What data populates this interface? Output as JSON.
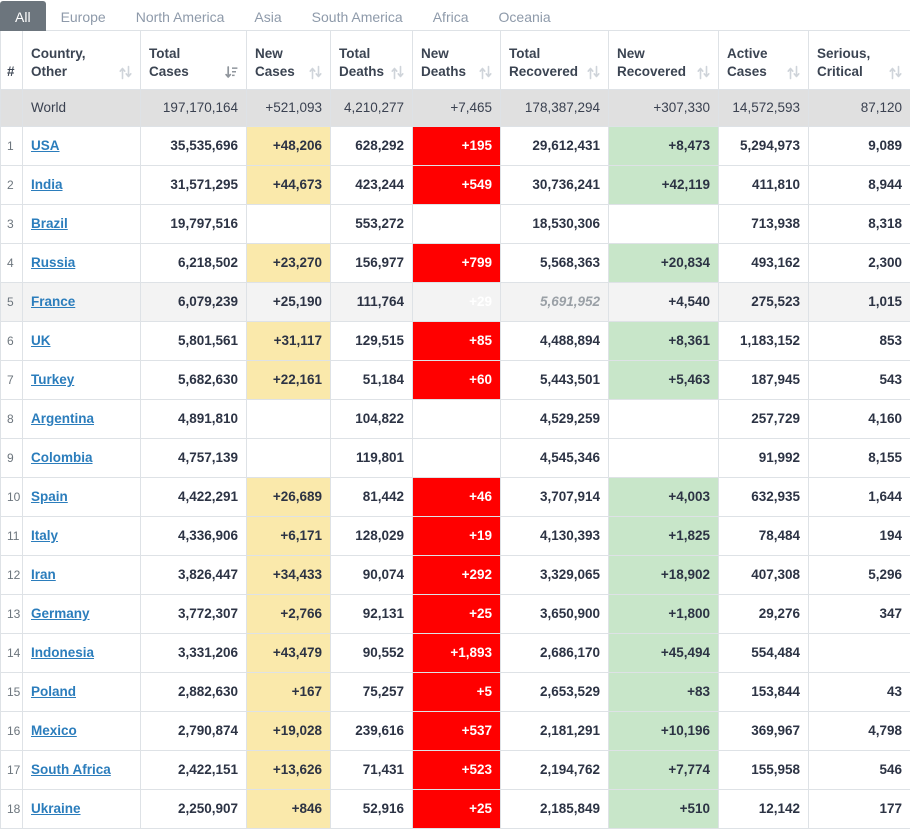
{
  "tabs": [
    {
      "label": "All",
      "active": true
    },
    {
      "label": "Europe",
      "active": false
    },
    {
      "label": "North America",
      "active": false
    },
    {
      "label": "Asia",
      "active": false
    },
    {
      "label": "South America",
      "active": false
    },
    {
      "label": "Africa",
      "active": false
    },
    {
      "label": "Oceania",
      "active": false
    }
  ],
  "colors": {
    "new_cases_bg": "#fae9ab",
    "new_deaths_bg": "#ff0000",
    "new_recovered_bg": "#c8e6c9",
    "world_row_bg": "#e0e0e0",
    "striped_row_bg": "#f3f3f3",
    "link": "#2b7dbc",
    "active_tab_bg": "#6c757d"
  },
  "columns": [
    {
      "key": "num",
      "line1": "",
      "line2": "#",
      "sort": "none"
    },
    {
      "key": "country",
      "line1": "Country,",
      "line2": "Other",
      "sort": "none"
    },
    {
      "key": "total_cases",
      "line1": "Total",
      "line2": "Cases",
      "sort": "desc"
    },
    {
      "key": "new_cases",
      "line1": "New",
      "line2": "Cases",
      "sort": "none"
    },
    {
      "key": "total_deaths",
      "line1": "Total",
      "line2": "Deaths",
      "sort": "none"
    },
    {
      "key": "new_deaths",
      "line1": "New",
      "line2": "Deaths",
      "sort": "none"
    },
    {
      "key": "total_recovered",
      "line1": "Total",
      "line2": "Recovered",
      "sort": "none"
    },
    {
      "key": "new_recovered",
      "line1": "New",
      "line2": "Recovered",
      "sort": "none"
    },
    {
      "key": "active_cases",
      "line1": "Active",
      "line2": "Cases",
      "sort": "none"
    },
    {
      "key": "serious_critical",
      "line1": "Serious,",
      "line2": "Critical",
      "sort": "none"
    }
  ],
  "world_row": {
    "num": "",
    "country": "World",
    "total_cases": "197,170,164",
    "new_cases": "+521,093",
    "total_deaths": "4,210,277",
    "new_deaths": "+7,465",
    "total_recovered": "178,387,294",
    "new_recovered": "+307,330",
    "active_cases": "14,572,593",
    "serious_critical": "87,120"
  },
  "rows": [
    {
      "num": "1",
      "country": "USA",
      "total_cases": "35,535,696",
      "new_cases": "+48,206",
      "total_deaths": "628,292",
      "new_deaths": "+195",
      "total_recovered": "29,612,431",
      "new_recovered": "+8,473",
      "active_cases": "5,294,973",
      "serious_critical": "9,089",
      "striped": false,
      "recovered_muted": false
    },
    {
      "num": "2",
      "country": "India",
      "total_cases": "31,571,295",
      "new_cases": "+44,673",
      "total_deaths": "423,244",
      "new_deaths": "+549",
      "total_recovered": "30,736,241",
      "new_recovered": "+42,119",
      "active_cases": "411,810",
      "serious_critical": "8,944",
      "striped": false,
      "recovered_muted": false
    },
    {
      "num": "3",
      "country": "Brazil",
      "total_cases": "19,797,516",
      "new_cases": "",
      "total_deaths": "553,272",
      "new_deaths": "",
      "total_recovered": "18,530,306",
      "new_recovered": "",
      "active_cases": "713,938",
      "serious_critical": "8,318",
      "striped": false,
      "recovered_muted": false
    },
    {
      "num": "4",
      "country": "Russia",
      "total_cases": "6,218,502",
      "new_cases": "+23,270",
      "total_deaths": "156,977",
      "new_deaths": "+799",
      "total_recovered": "5,568,363",
      "new_recovered": "+20,834",
      "active_cases": "493,162",
      "serious_critical": "2,300",
      "striped": false,
      "recovered_muted": false
    },
    {
      "num": "5",
      "country": "France",
      "total_cases": "6,079,239",
      "new_cases": "+25,190",
      "total_deaths": "111,764",
      "new_deaths": "+29",
      "total_recovered": "5,691,952",
      "new_recovered": "+4,540",
      "active_cases": "275,523",
      "serious_critical": "1,015",
      "striped": true,
      "recovered_muted": true
    },
    {
      "num": "6",
      "country": "UK",
      "total_cases": "5,801,561",
      "new_cases": "+31,117",
      "total_deaths": "129,515",
      "new_deaths": "+85",
      "total_recovered": "4,488,894",
      "new_recovered": "+8,361",
      "active_cases": "1,183,152",
      "serious_critical": "853",
      "striped": false,
      "recovered_muted": false
    },
    {
      "num": "7",
      "country": "Turkey",
      "total_cases": "5,682,630",
      "new_cases": "+22,161",
      "total_deaths": "51,184",
      "new_deaths": "+60",
      "total_recovered": "5,443,501",
      "new_recovered": "+5,463",
      "active_cases": "187,945",
      "serious_critical": "543",
      "striped": false,
      "recovered_muted": false
    },
    {
      "num": "8",
      "country": "Argentina",
      "total_cases": "4,891,810",
      "new_cases": "",
      "total_deaths": "104,822",
      "new_deaths": "",
      "total_recovered": "4,529,259",
      "new_recovered": "",
      "active_cases": "257,729",
      "serious_critical": "4,160",
      "striped": false,
      "recovered_muted": false
    },
    {
      "num": "9",
      "country": "Colombia",
      "total_cases": "4,757,139",
      "new_cases": "",
      "total_deaths": "119,801",
      "new_deaths": "",
      "total_recovered": "4,545,346",
      "new_recovered": "",
      "active_cases": "91,992",
      "serious_critical": "8,155",
      "striped": false,
      "recovered_muted": false
    },
    {
      "num": "10",
      "country": "Spain",
      "total_cases": "4,422,291",
      "new_cases": "+26,689",
      "total_deaths": "81,442",
      "new_deaths": "+46",
      "total_recovered": "3,707,914",
      "new_recovered": "+4,003",
      "active_cases": "632,935",
      "serious_critical": "1,644",
      "striped": false,
      "recovered_muted": false
    },
    {
      "num": "11",
      "country": "Italy",
      "total_cases": "4,336,906",
      "new_cases": "+6,171",
      "total_deaths": "128,029",
      "new_deaths": "+19",
      "total_recovered": "4,130,393",
      "new_recovered": "+1,825",
      "active_cases": "78,484",
      "serious_critical": "194",
      "striped": false,
      "recovered_muted": false
    },
    {
      "num": "12",
      "country": "Iran",
      "total_cases": "3,826,447",
      "new_cases": "+34,433",
      "total_deaths": "90,074",
      "new_deaths": "+292",
      "total_recovered": "3,329,065",
      "new_recovered": "+18,902",
      "active_cases": "407,308",
      "serious_critical": "5,296",
      "striped": false,
      "recovered_muted": false
    },
    {
      "num": "13",
      "country": "Germany",
      "total_cases": "3,772,307",
      "new_cases": "+2,766",
      "total_deaths": "92,131",
      "new_deaths": "+25",
      "total_recovered": "3,650,900",
      "new_recovered": "+1,800",
      "active_cases": "29,276",
      "serious_critical": "347",
      "striped": false,
      "recovered_muted": false
    },
    {
      "num": "14",
      "country": "Indonesia",
      "total_cases": "3,331,206",
      "new_cases": "+43,479",
      "total_deaths": "90,552",
      "new_deaths": "+1,893",
      "total_recovered": "2,686,170",
      "new_recovered": "+45,494",
      "active_cases": "554,484",
      "serious_critical": "",
      "striped": false,
      "recovered_muted": false
    },
    {
      "num": "15",
      "country": "Poland",
      "total_cases": "2,882,630",
      "new_cases": "+167",
      "total_deaths": "75,257",
      "new_deaths": "+5",
      "total_recovered": "2,653,529",
      "new_recovered": "+83",
      "active_cases": "153,844",
      "serious_critical": "43",
      "striped": false,
      "recovered_muted": false
    },
    {
      "num": "16",
      "country": "Mexico",
      "total_cases": "2,790,874",
      "new_cases": "+19,028",
      "total_deaths": "239,616",
      "new_deaths": "+537",
      "total_recovered": "2,181,291",
      "new_recovered": "+10,196",
      "active_cases": "369,967",
      "serious_critical": "4,798",
      "striped": false,
      "recovered_muted": false
    },
    {
      "num": "17",
      "country": "South Africa",
      "total_cases": "2,422,151",
      "new_cases": "+13,626",
      "total_deaths": "71,431",
      "new_deaths": "+523",
      "total_recovered": "2,194,762",
      "new_recovered": "+7,774",
      "active_cases": "155,958",
      "serious_critical": "546",
      "striped": false,
      "recovered_muted": false
    },
    {
      "num": "18",
      "country": "Ukraine",
      "total_cases": "2,250,907",
      "new_cases": "+846",
      "total_deaths": "52,916",
      "new_deaths": "+25",
      "total_recovered": "2,185,849",
      "new_recovered": "+510",
      "active_cases": "12,142",
      "serious_critical": "177",
      "striped": false,
      "recovered_muted": false
    }
  ]
}
